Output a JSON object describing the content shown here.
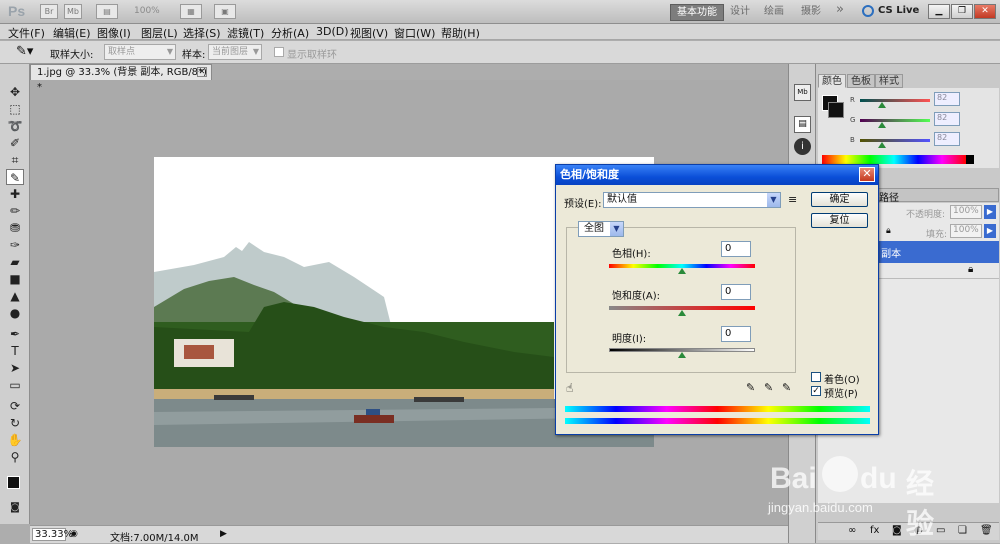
{
  "app": {
    "logo": "Ps",
    "icon_labels": [
      "Br",
      "Mb"
    ],
    "zoom": "100%",
    "workspaces": [
      "基本功能",
      "设计",
      "绘画",
      "摄影"
    ],
    "more": "»",
    "cs_live": "CS Live"
  },
  "menu": [
    "文件(F)",
    "编辑(E)",
    "图像(I)",
    "图层(L)",
    "选择(S)",
    "滤镜(T)",
    "分析(A)",
    "3D(D)",
    "视图(V)",
    "窗口(W)",
    "帮助(H)"
  ],
  "options": {
    "sample_size_label": "取样大小:",
    "sample_size_value": "取样点",
    "sample_label": "样本:",
    "sample_value": "当前图层",
    "show_ring": "显示取样环"
  },
  "document": {
    "tab_title": "1.jpg @ 33.3% (背景 副本, RGB/8*) *",
    "zoom": "33.33%",
    "doc_info": "文档:7.00M/14.0M"
  },
  "panels": {
    "color_tabs": [
      "颜色",
      "色板",
      "样式"
    ],
    "rgb_labels": [
      "R",
      "G",
      "B"
    ],
    "rgb_values": [
      "82",
      "82",
      "82"
    ],
    "layers_opacity_label": "不透明度:",
    "layers_opacity": "100%",
    "fill_label": "填充:",
    "fill_value": "100%",
    "layer_name": "背景 副本",
    "layers_tab": "路径"
  },
  "dialog": {
    "title": "色相/饱和度",
    "preset_label": "预设(E):",
    "preset_value": "默认值",
    "ok": "确定",
    "reset": "复位",
    "channel": "全图",
    "hue_label": "色相(H):",
    "hue_value": "0",
    "saturation_label": "饱和度(A):",
    "saturation_value": "0",
    "lightness_label": "明度(I):",
    "lightness_value": "0",
    "colorize": "着色(O)",
    "preview": "预览(P)",
    "preview_checked": true,
    "colorize_checked": false
  },
  "watermark": {
    "brand": "Bai",
    "brand2": "du",
    "brand_cn": "经验",
    "url": "jingyan.baidu.com"
  }
}
